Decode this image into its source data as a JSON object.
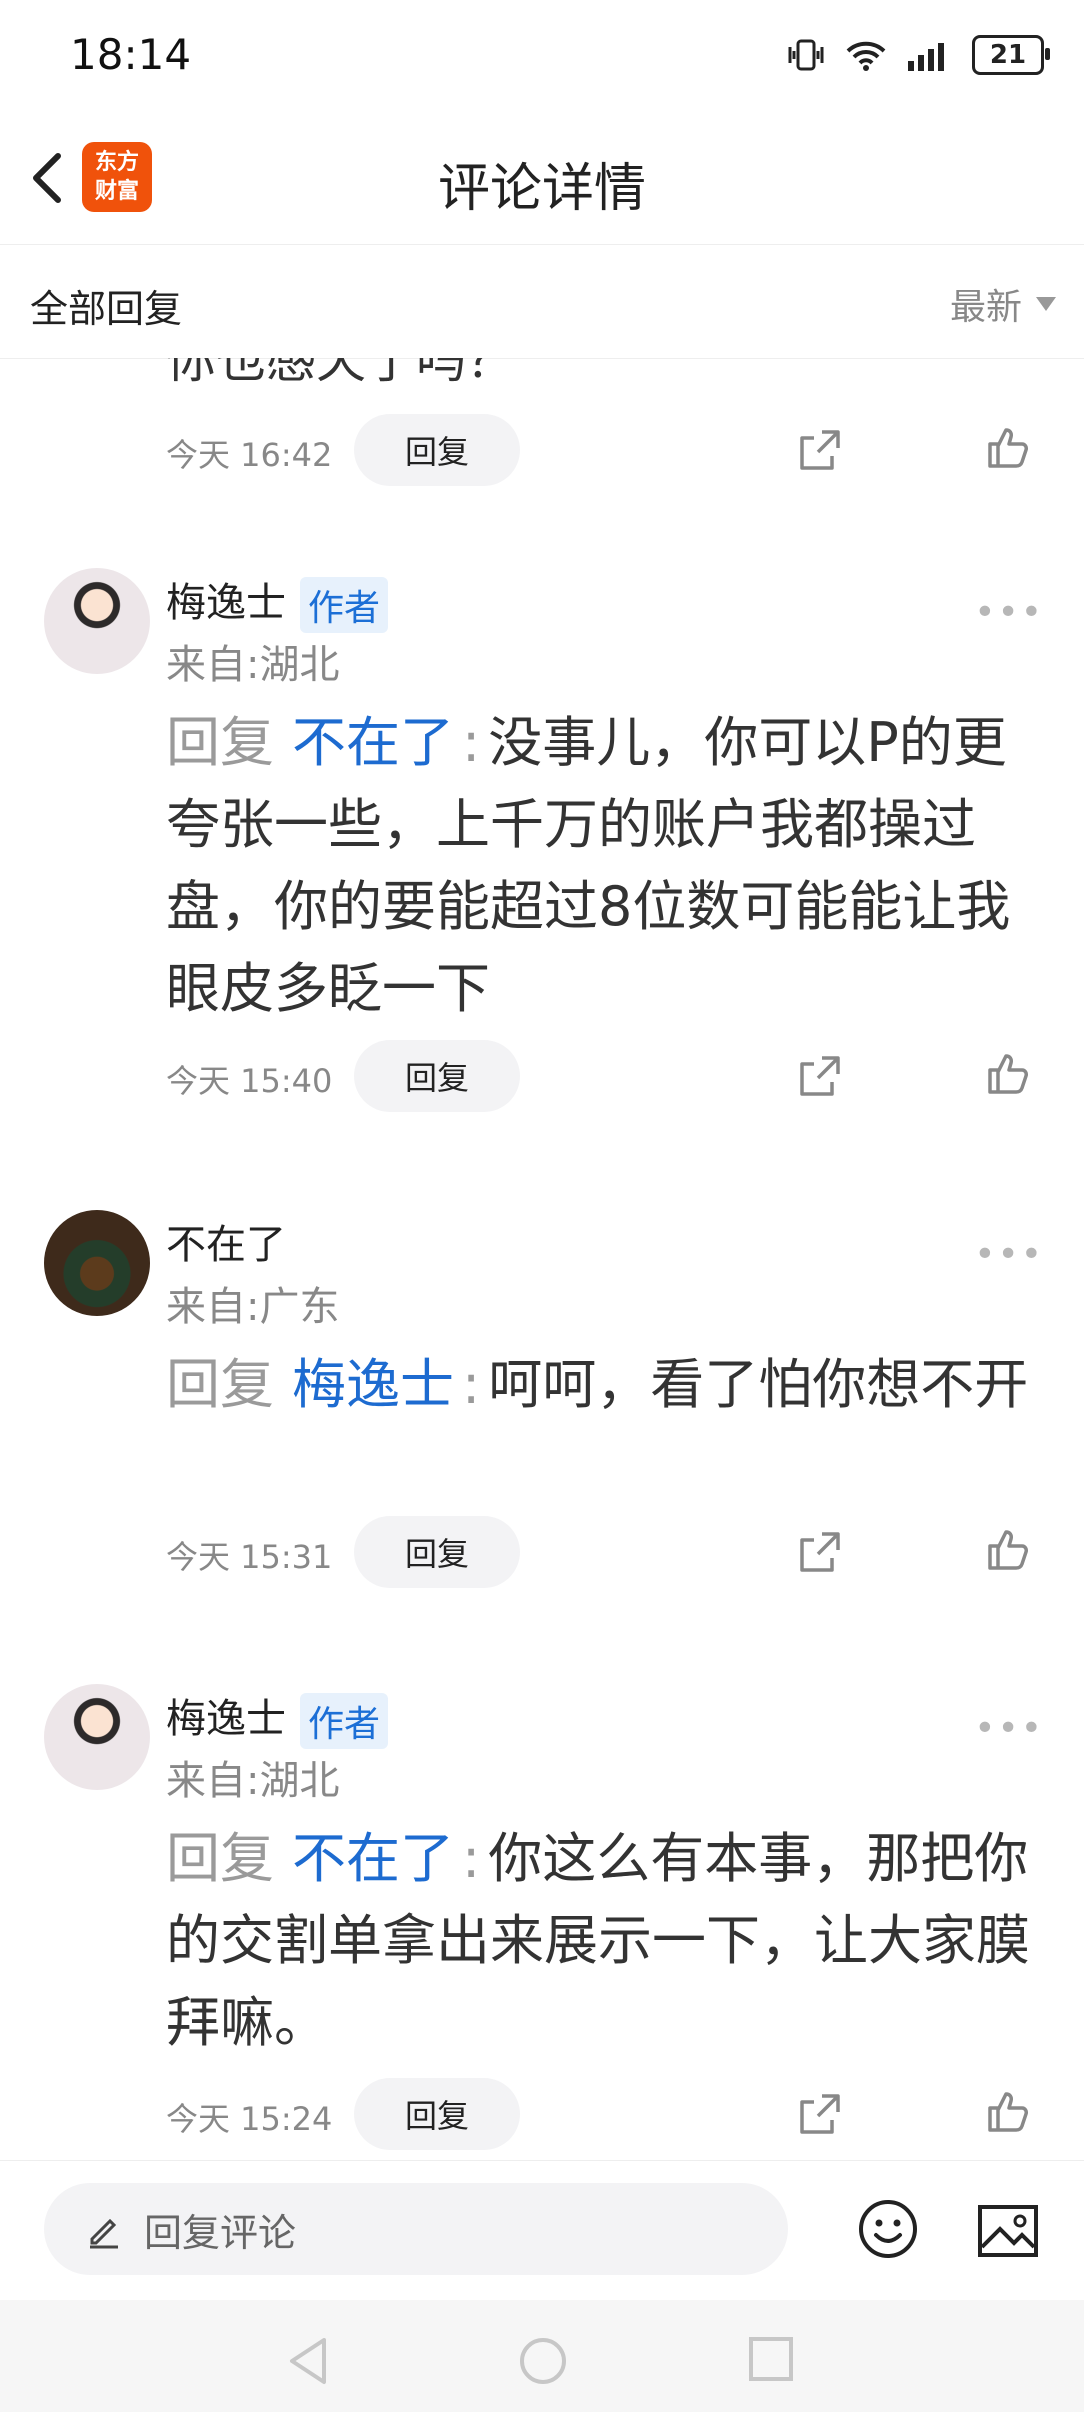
{
  "status": {
    "time": "18:14",
    "battery": "21"
  },
  "header": {
    "title": "评论详情",
    "logo_line1": "东方",
    "logo_line2": "财富"
  },
  "filter": {
    "title": "全部回复",
    "sort": "最新"
  },
  "partial": {
    "text": "你也感天了吗？"
  },
  "comments": [
    {
      "time": "今天 16:42",
      "reply_label": "回复"
    },
    {
      "name": "梅逸士",
      "tag": "作者",
      "location": "来自:湖北",
      "prefix": "回复",
      "target": "不在了",
      "colon": ":",
      "text": "没事儿，你可以P的更夸张一些，上千万的账户我都操过盘，你的要能超过8位数可能能让我眼皮多眨一下",
      "time": "今天 15:40",
      "reply_label": "回复"
    },
    {
      "name": "不在了",
      "location": "来自:广东",
      "prefix": "回复",
      "target": "梅逸士",
      "colon": ":",
      "text": "呵呵，看了怕你想不开",
      "time": "今天 15:31",
      "reply_label": "回复"
    },
    {
      "name": "梅逸士",
      "tag": "作者",
      "location": "来自:湖北",
      "prefix": "回复",
      "target": "不在了",
      "colon": ":",
      "text": "你这么有本事，那把你的交割单拿出来展示一下，让大家膜拜嘛。",
      "time": "今天 15:24",
      "reply_label": "回复"
    }
  ],
  "composer": {
    "placeholder": "回复评论"
  },
  "colors": {
    "brand": "#f0520b",
    "link": "#1d6bd0",
    "tag_bg": "#e7f1fc"
  }
}
